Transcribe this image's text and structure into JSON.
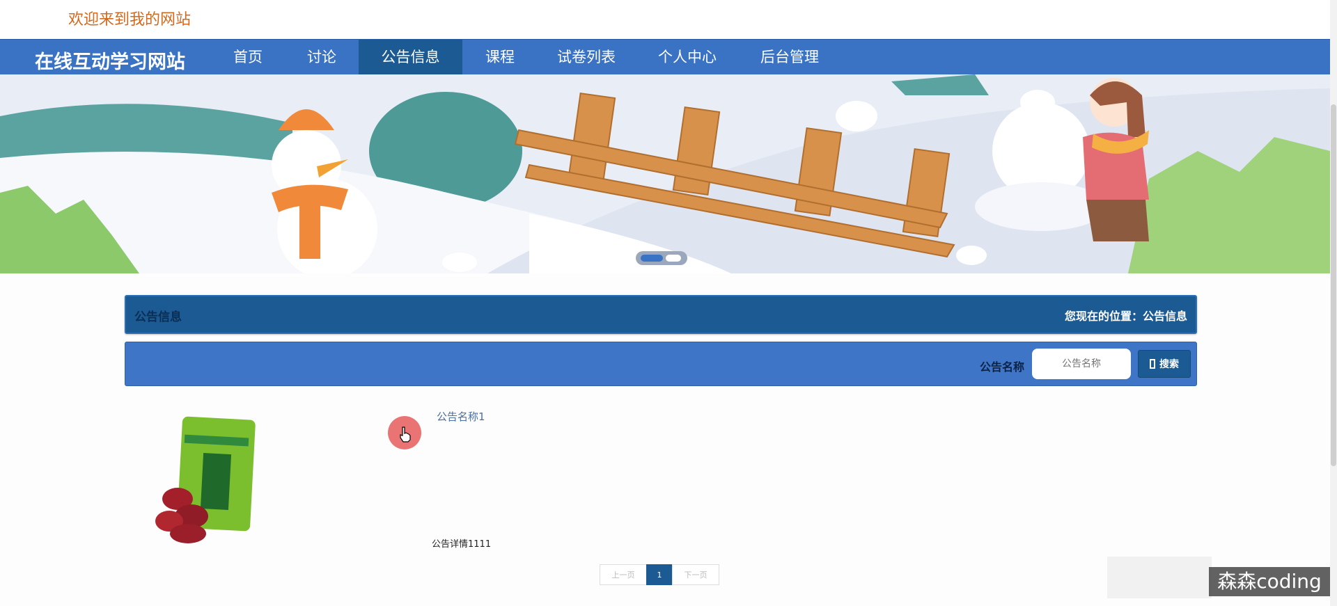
{
  "welcome": "欢迎来到我的网站",
  "site_title": "在线互动学习网站",
  "nav": [
    {
      "label": "首页"
    },
    {
      "label": "讨论"
    },
    {
      "label": "公告信息",
      "active": true
    },
    {
      "label": "课程"
    },
    {
      "label": "试卷列表"
    },
    {
      "label": "个人中心"
    },
    {
      "label": "后台管理"
    }
  ],
  "banner": {
    "slide_count": 2,
    "active_slide": 1
  },
  "section": {
    "title": "公告信息",
    "location": "您现在的位置：公告信息"
  },
  "search": {
    "label": "公告名称",
    "placeholder": "公告名称",
    "button": "搜索"
  },
  "notices": [
    {
      "title": "公告名称1",
      "detail": "公告详情1111"
    }
  ],
  "pagination": {
    "prev": "上一页",
    "current": "1",
    "next": "下一页"
  },
  "watermark": "森森coding",
  "colors": {
    "primary": "#3b73c4",
    "dark": "#1b5a92",
    "welcome": "#d2691e"
  }
}
